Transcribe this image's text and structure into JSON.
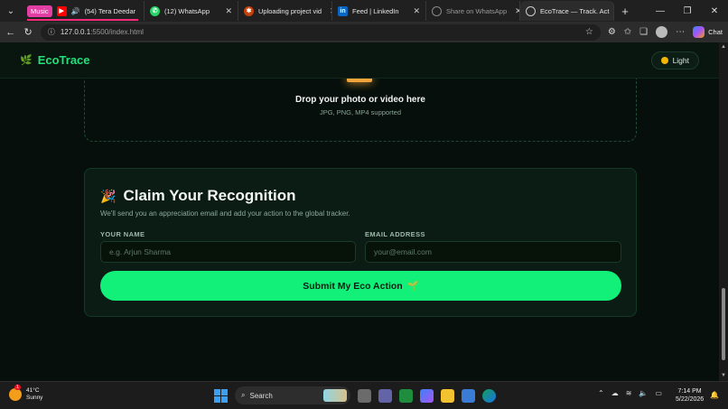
{
  "browser": {
    "tabs": [
      {
        "badge": "Music",
        "title": "(54) Tera Deedar",
        "active": false
      },
      {
        "title": "(12) WhatsApp",
        "active": false
      },
      {
        "title": "Uploading project vid",
        "active": false
      },
      {
        "title": "Feed | LinkedIn",
        "active": false
      },
      {
        "title": "Share on WhatsApp",
        "active": false
      },
      {
        "title": "EcoTrace — Track. Act",
        "active": true
      }
    ],
    "url_host": "127.0.0.1",
    "url_path": ":5500/index.html",
    "chat_label": "Chat"
  },
  "page": {
    "brand": "EcoTrace",
    "theme_toggle": "Light",
    "dropzone": {
      "title": "Drop your photo or video here",
      "subtitle": "JPG, PNG, MP4 supported"
    },
    "claim": {
      "emoji": "🎉",
      "title": "Claim Your Recognition",
      "subtitle": "We'll send you an appreciation email and add your action to the global tracker.",
      "name_label": "YOUR NAME",
      "name_placeholder": "e.g. Arjun Sharma",
      "email_label": "EMAIL ADDRESS",
      "email_placeholder": "your@email.com",
      "submit_label": "Submit My Eco Action",
      "submit_emoji": "🌱"
    }
  },
  "taskbar": {
    "weather_temp": "41°C",
    "weather_desc": "Sunny",
    "weather_badge": "1",
    "search_label": "Search",
    "time": "7:14 PM",
    "date": "5/22/2026"
  },
  "colors": {
    "accent": "#12f07a",
    "brand": "#22e07a",
    "background": "#060f0b"
  }
}
